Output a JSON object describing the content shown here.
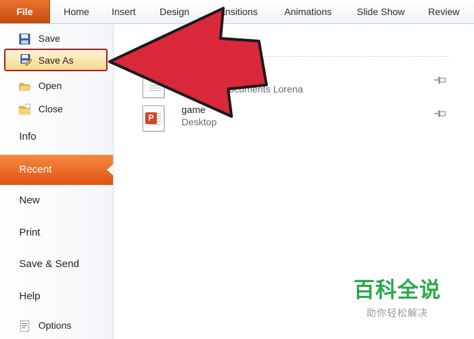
{
  "ribbon": {
    "file_tab": "File",
    "tabs": [
      "Home",
      "Insert",
      "Design",
      "ansitions",
      "Animations",
      "Slide Show",
      "Review"
    ]
  },
  "backstage": {
    "commands": {
      "save": "Save",
      "save_as": "Save As",
      "open": "Open",
      "close": "Close"
    },
    "nav": {
      "info": "Info",
      "recent": "Recent",
      "new": "New",
      "print": "Print",
      "save_send": "Save & Send",
      "help": "Help",
      "options": "Options"
    }
  },
  "recent_files": [
    {
      "name": "",
      "path": "Documents Lorena"
    },
    {
      "name": "game",
      "path": "Desktop",
      "badge": "P"
    }
  ],
  "colors": {
    "file_tab": "#d15a17",
    "recent_highlight": "#ec6e27",
    "arrow": "#d8283a",
    "arrow_outline": "#1a1a1a",
    "saveas_border": "#a31e2a",
    "watermark": "#2aa84a"
  },
  "watermark": {
    "line1": "百科全说",
    "line2": "助你轻松解决"
  }
}
